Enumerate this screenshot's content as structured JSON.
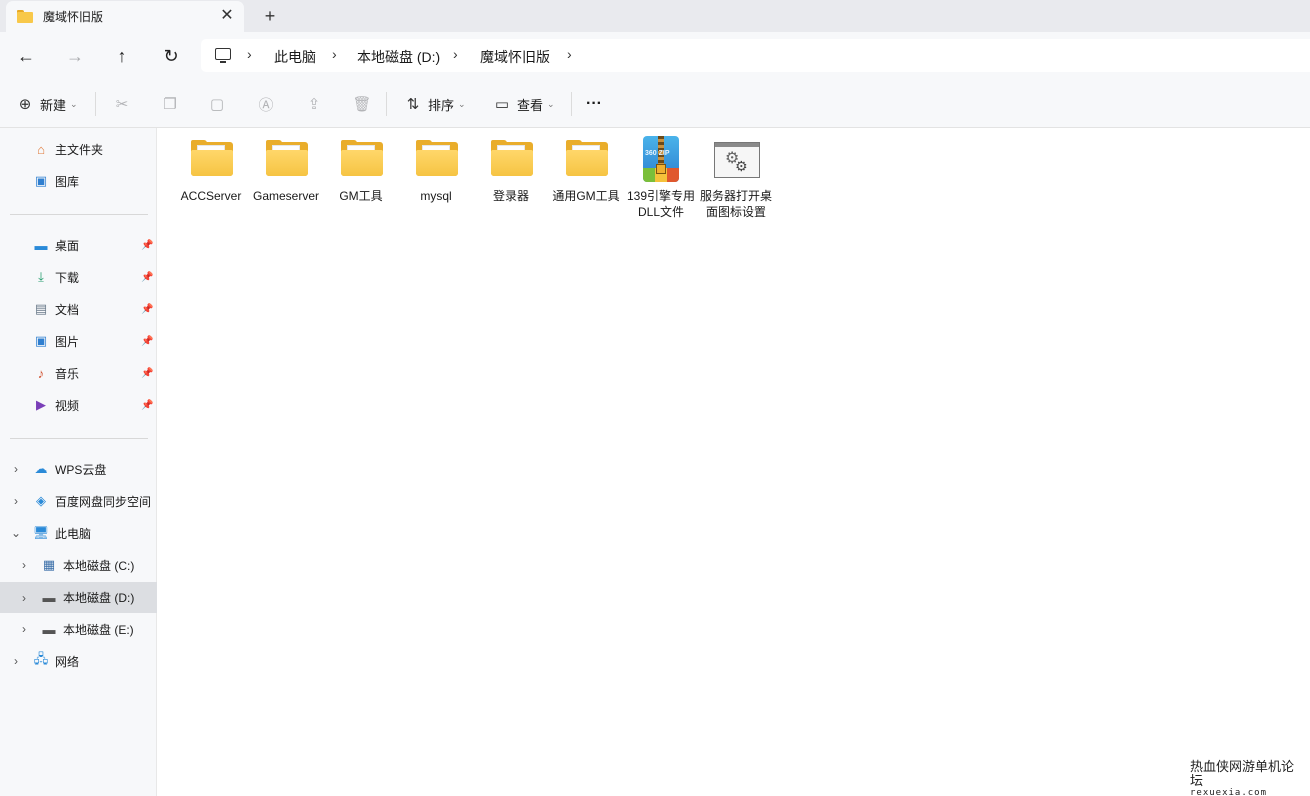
{
  "window": {
    "tab_title": "魔域怀旧版",
    "tab_close": "✕",
    "new_tab": "+"
  },
  "nav": {
    "back": "←",
    "forward": "→",
    "up": "↑",
    "refresh": "↻",
    "breadcrumb": [
      "此电脑",
      "本地磁盘 (D:)",
      "魔域怀旧版"
    ],
    "sep": "›"
  },
  "toolbar": {
    "new_label": "新建",
    "sort_label": "排序",
    "view_label": "查看",
    "more_label": "···",
    "caret": "⌄"
  },
  "sidebar": {
    "quick": [
      {
        "label": "主文件夹",
        "icon": "home-icon"
      },
      {
        "label": "图库",
        "icon": "gallery-icon"
      }
    ],
    "pinned": [
      {
        "label": "桌面",
        "icon": "desktop-icon"
      },
      {
        "label": "下载",
        "icon": "download-icon"
      },
      {
        "label": "文档",
        "icon": "document-icon"
      },
      {
        "label": "图片",
        "icon": "pictures-icon"
      },
      {
        "label": "音乐",
        "icon": "music-icon"
      },
      {
        "label": "视频",
        "icon": "video-icon"
      }
    ],
    "tree": [
      {
        "label": "WPS云盘",
        "icon": "cloud-icon"
      },
      {
        "label": "百度网盘同步空间",
        "icon": "baidu-icon"
      },
      {
        "label": "此电脑",
        "icon": "pc-icon"
      },
      {
        "label": "本地磁盘 (C:)",
        "icon": "drive-c-icon"
      },
      {
        "label": "本地磁盘 (D:)",
        "icon": "drive-icon"
      },
      {
        "label": "本地磁盘 (E:)",
        "icon": "drive-icon"
      },
      {
        "label": "网络",
        "icon": "network-icon"
      }
    ]
  },
  "files": [
    {
      "name": "ACCServer",
      "type": "folder"
    },
    {
      "name": "Gameserver",
      "type": "folder"
    },
    {
      "name": "GM工具",
      "type": "folder"
    },
    {
      "name": "mysql",
      "type": "folder"
    },
    {
      "name": "登录器",
      "type": "folder"
    },
    {
      "name": "通用GM工具",
      "type": "folder"
    },
    {
      "name": "139引擎专用DLL文件",
      "type": "zip",
      "badge": "360 ZIP"
    },
    {
      "name": "服务器打开桌面图标设置",
      "type": "settings"
    }
  ],
  "watermark": {
    "title": "热血侠网游单机论坛",
    "url": "rexuexia.com"
  }
}
